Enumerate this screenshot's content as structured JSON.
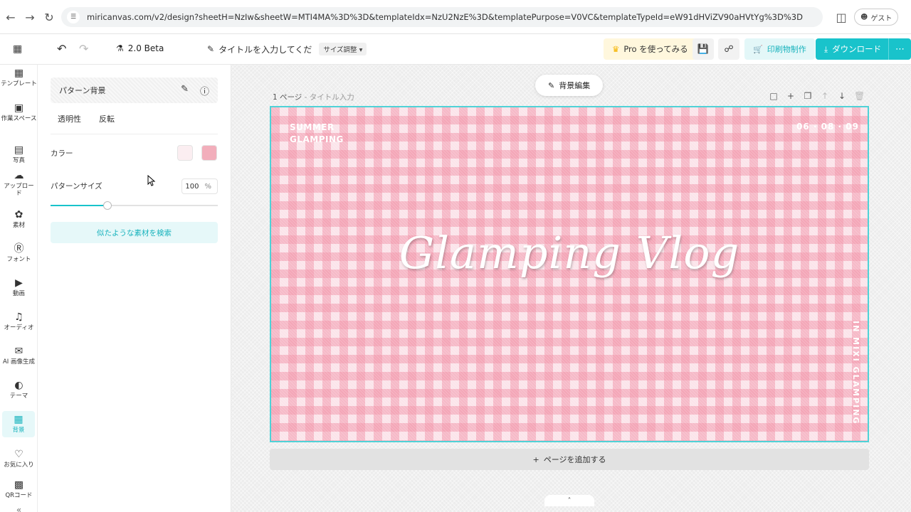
{
  "browser": {
    "url": "miricanvas.com/v2/design?sheetH=NzIw&sheetW=MTI4MA%3D%3D&templateIdx=NzU2NzE%3D&templatePurpose=V0VC&templateTypeId=eW91dHViZV90aHVtYg%3D%3D",
    "guest_label": "ゲスト"
  },
  "header": {
    "version_label": "2.0 Beta",
    "title_placeholder": "タイトルを入力してくだ",
    "resize_label": "サイズ調整",
    "pro_label": "Pro を使ってみる",
    "print_label": "印刷物制作",
    "download_label": "ダウンロード"
  },
  "rail": {
    "items": [
      {
        "label": "テンプレート"
      },
      {
        "label": "作業スペース"
      },
      {
        "label": "写真"
      },
      {
        "label": "アップロード"
      },
      {
        "label": "素材"
      },
      {
        "label": "フォント"
      },
      {
        "label": "動画"
      },
      {
        "label": "オーディオ"
      },
      {
        "label": "AI 画像生成"
      },
      {
        "label": "テーマ"
      },
      {
        "label": "背景"
      },
      {
        "label": "お気に入り"
      },
      {
        "label": "QRコード"
      }
    ]
  },
  "panel": {
    "pattern_title": "パターン背景",
    "tabs": [
      "透明性",
      "反転"
    ],
    "color_label": "カラー",
    "colors": [
      "#fbeef1",
      "#f2aebb"
    ],
    "size_label": "パターンサイズ",
    "size_value": "100",
    "size_unit": "%",
    "size_slider_fraction": 0.34,
    "similar_button": "似たような素材を検索"
  },
  "canvas": {
    "bg_edit_label": "背景編集",
    "page_number": "1 ページ",
    "page_title_placeholder": "- タイトル入力",
    "add_page_label": "ページを追加する",
    "design": {
      "top_left_line1": "SUMMER",
      "top_left_line2": "GLAMPING",
      "top_right": "06 · 08 · 09",
      "script_title": "Glamping Vlog",
      "vertical_text": "IN MIXI GLAMPING"
    }
  },
  "colors": {
    "accent": "#19c3cb",
    "pattern_pink": "#f296aa",
    "pattern_light": "#fbe4ea"
  }
}
